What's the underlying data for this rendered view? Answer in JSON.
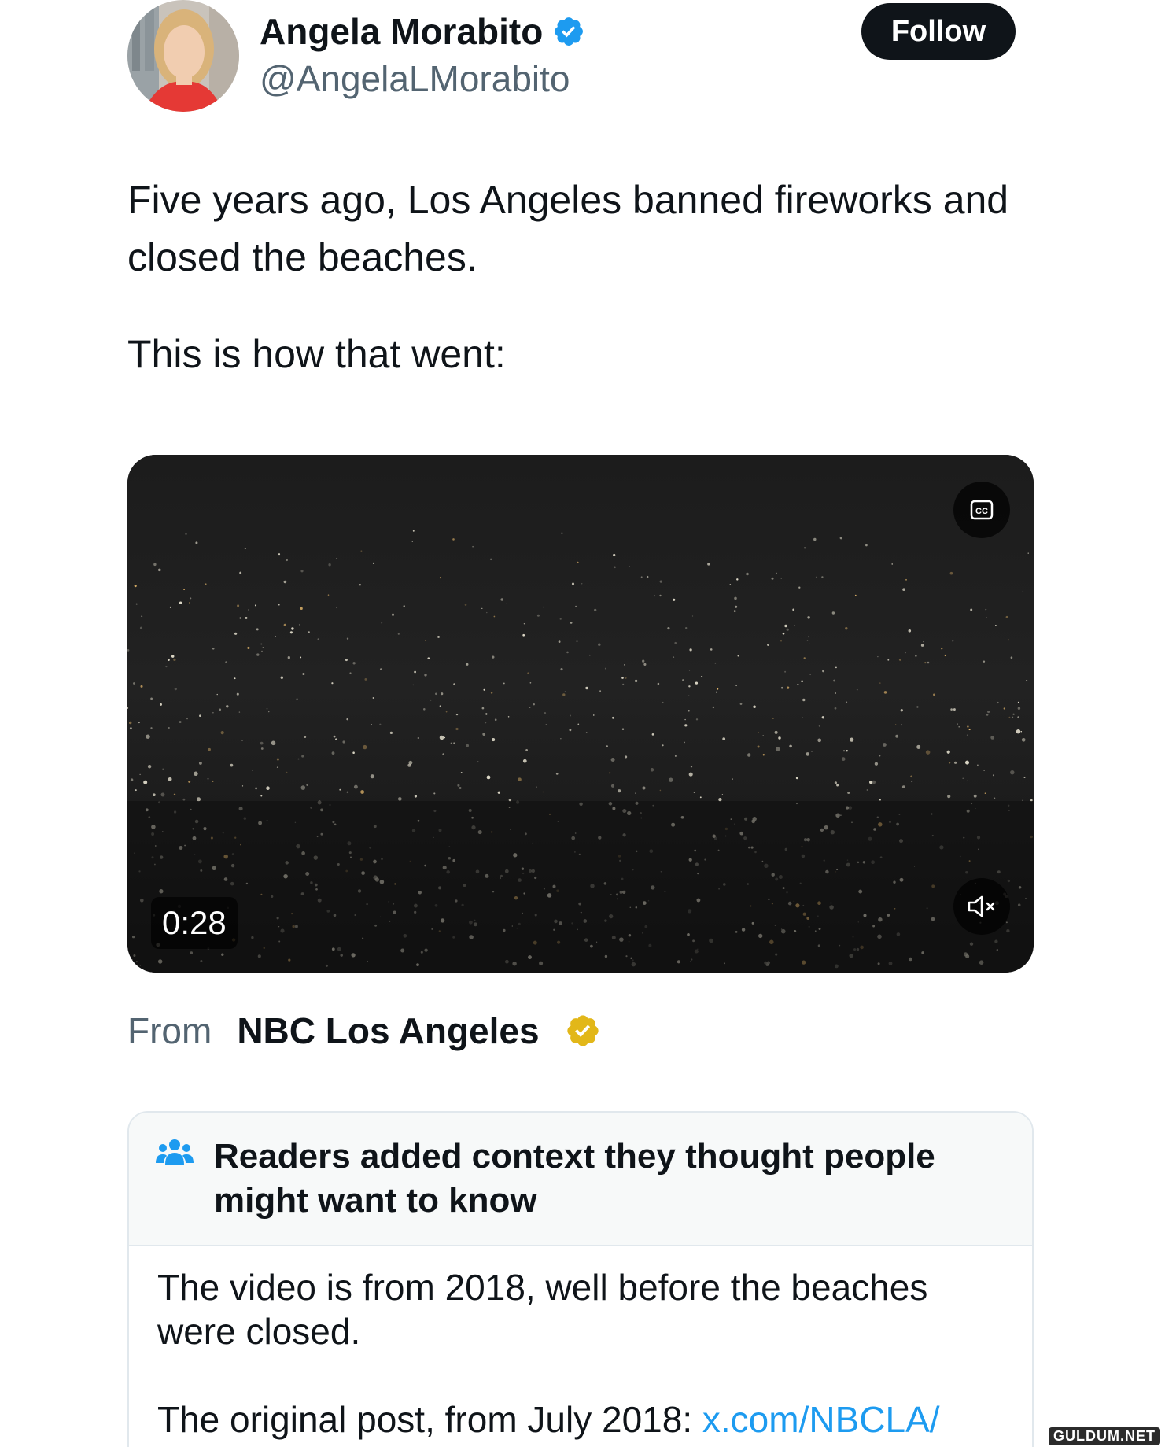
{
  "author": {
    "display_name": "Angela Morabito",
    "handle": "@AngelaLMorabito",
    "verified_color": "#1d9bf0"
  },
  "follow_button": {
    "label": "Follow"
  },
  "tweet": {
    "paragraphs": [
      "Five years ago, Los Angeles banned fireworks and closed the beaches.",
      "This is how that went:"
    ]
  },
  "video": {
    "duration": "0:28",
    "captions_icon": "cc-icon",
    "mute_icon": "muted-speaker-icon"
  },
  "source": {
    "from_label": "From",
    "name": "NBC Los Angeles",
    "badge_color": "#e2b719"
  },
  "community_note": {
    "title": "Readers added context they thought people might want to know",
    "body": "The video is from 2018, well before the beaches were closed.",
    "original_prefix": "The original post, from July 2018: ",
    "original_link": "x.com/NBCLA/"
  },
  "watermark": "GULDUM.NET"
}
